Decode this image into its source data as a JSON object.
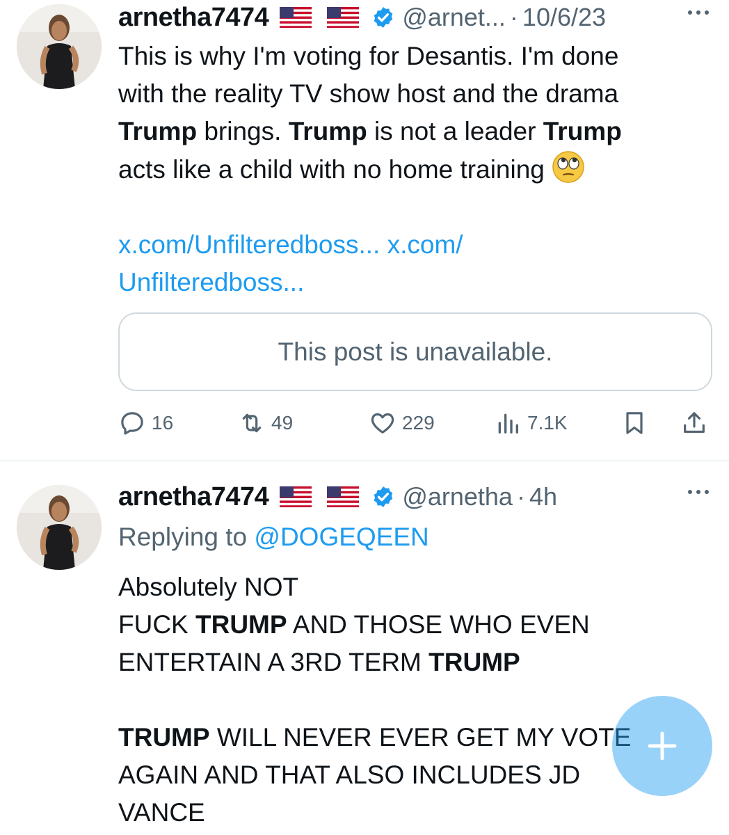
{
  "tweets": [
    {
      "display_name": "arnetha7474",
      "handle": "@arnet...",
      "separator": "·",
      "time": "10/6/23",
      "body": {
        "line1": "This is why I'm voting for Desantis. I'm done",
        "line2": "with the reality TV show host and the drama",
        "line3_b1": "Trump",
        "line3_t1": " brings. ",
        "line3_b2": "Trump",
        "line3_t2": " is not a leader ",
        "line3_b3": "Trump",
        "line4": "acts like a child with no home training",
        "link_line1": "x.com/Unfilteredboss... x.com/",
        "link_line2": "Unfilteredboss..."
      },
      "quote_text": "This post is unavailable.",
      "actions": {
        "replies": "16",
        "retweets": "49",
        "likes": "229",
        "views": "7.1K"
      }
    },
    {
      "display_name": "arnetha7474",
      "handle": "@arnetha",
      "separator": "·",
      "time": "4h",
      "replying_prefix": "Replying to ",
      "replying_to": "@DOGEQEEN",
      "body": {
        "line1": "Absolutely NOT",
        "line2_t1": "FUCK ",
        "line2_b1": "TRUMP",
        "line2_t2": " AND THOSE WHO EVEN",
        "line3_t1": "ENTERTAIN A 3RD TERM ",
        "line3_b1": "TRUMP",
        "line5_b1": "TRUMP",
        "line5_t1": " WILL NEVER EVER GET MY VOTE",
        "line6": "AGAIN AND THAT ALSO INCLUDES JD",
        "line7": "VANCE"
      }
    }
  ],
  "icons": {
    "flag": "us-flag-icon",
    "verified": "verified-badge-icon",
    "more": "more-icon",
    "reply": "reply-icon",
    "retweet": "retweet-icon",
    "like": "heart-icon",
    "views": "views-icon",
    "bookmark": "bookmark-icon",
    "share": "share-icon",
    "compose": "plus-icon",
    "emoji": "face-with-rolling-eyes"
  },
  "colors": {
    "link": "#1d9bf0",
    "secondary_text": "#536471",
    "primary_text": "#0f1419",
    "verified": "#1d9bf0",
    "fab": "#1d9bf0"
  }
}
